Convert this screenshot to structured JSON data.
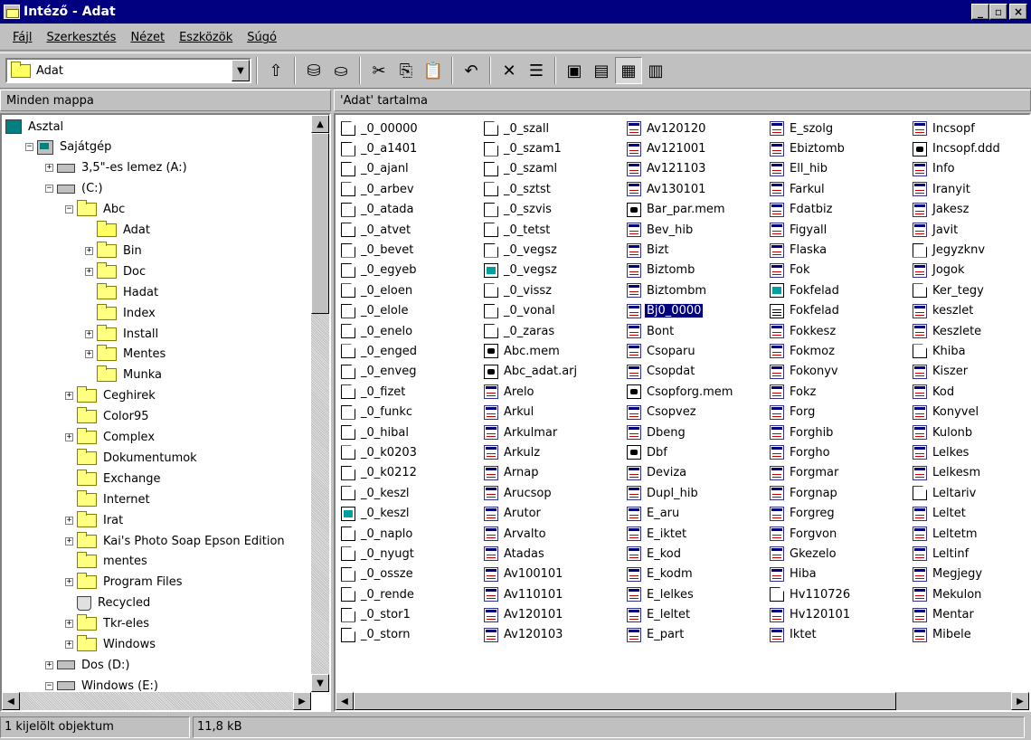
{
  "window": {
    "title": "Intéző - Adat",
    "min_glyph": "_",
    "max_glyph": "▫",
    "close_glyph": "×"
  },
  "menu": [
    "Fájl",
    "Szerkesztés",
    "Nézet",
    "Eszközök",
    "Súgó"
  ],
  "toolbar": {
    "address_value": "Adat",
    "dropdown_glyph": "▼",
    "buttons": [
      {
        "name": "up-folder-button",
        "glyph": "⇧"
      },
      {
        "name": "map-drive-button",
        "glyph": "⛁"
      },
      {
        "name": "disconnect-drive-button",
        "glyph": "⛀"
      },
      {
        "name": "cut-button",
        "glyph": "✂"
      },
      {
        "name": "copy-button",
        "glyph": "⎘"
      },
      {
        "name": "paste-button",
        "glyph": "📋"
      },
      {
        "name": "undo-button",
        "glyph": "↶"
      },
      {
        "name": "delete-button",
        "glyph": "✕"
      },
      {
        "name": "properties-button",
        "glyph": "☰"
      },
      {
        "name": "large-icons-button",
        "glyph": "▣"
      },
      {
        "name": "small-icons-button",
        "glyph": "▤"
      },
      {
        "name": "list-view-button",
        "glyph": "▦"
      },
      {
        "name": "details-view-button",
        "glyph": "▥"
      }
    ]
  },
  "left_pane": {
    "header": "Minden mappa",
    "tree": [
      {
        "label": "Asztal",
        "icon": "desktop-icon",
        "indent": 0,
        "pm": ""
      },
      {
        "label": "Sajátgép",
        "icon": "computer-icon",
        "indent": 1,
        "pm": "−"
      },
      {
        "label": "3,5\"-es lemez (A:)",
        "icon": "floppy-drive-icon",
        "indent": 2,
        "pm": "+"
      },
      {
        "label": "(C:)",
        "icon": "hard-drive-icon",
        "indent": 2,
        "pm": "−"
      },
      {
        "label": "Abc",
        "icon": "folder-icon",
        "indent": 3,
        "pm": "−"
      },
      {
        "label": "Adat",
        "icon": "open-folder-icon",
        "indent": 4,
        "pm": ""
      },
      {
        "label": "Bin",
        "icon": "folder-icon",
        "indent": 4,
        "pm": "+"
      },
      {
        "label": "Doc",
        "icon": "folder-icon",
        "indent": 4,
        "pm": "+"
      },
      {
        "label": "Hadat",
        "icon": "folder-icon",
        "indent": 4,
        "pm": ""
      },
      {
        "label": "Index",
        "icon": "folder-icon",
        "indent": 4,
        "pm": ""
      },
      {
        "label": "Install",
        "icon": "folder-icon",
        "indent": 4,
        "pm": "+"
      },
      {
        "label": "Mentes",
        "icon": "folder-icon",
        "indent": 4,
        "pm": "+"
      },
      {
        "label": "Munka",
        "icon": "folder-icon",
        "indent": 4,
        "pm": ""
      },
      {
        "label": "Ceghirek",
        "icon": "folder-icon",
        "indent": 3,
        "pm": "+"
      },
      {
        "label": "Color95",
        "icon": "folder-icon",
        "indent": 3,
        "pm": ""
      },
      {
        "label": "Complex",
        "icon": "folder-icon",
        "indent": 3,
        "pm": "+"
      },
      {
        "label": "Dokumentumok",
        "icon": "folder-icon",
        "indent": 3,
        "pm": ""
      },
      {
        "label": "Exchange",
        "icon": "folder-icon",
        "indent": 3,
        "pm": ""
      },
      {
        "label": "Internet",
        "icon": "folder-icon",
        "indent": 3,
        "pm": ""
      },
      {
        "label": "Irat",
        "icon": "folder-icon",
        "indent": 3,
        "pm": "+"
      },
      {
        "label": "Kai's Photo Soap Epson Edition",
        "icon": "folder-icon",
        "indent": 3,
        "pm": "+"
      },
      {
        "label": "mentes",
        "icon": "folder-icon",
        "indent": 3,
        "pm": ""
      },
      {
        "label": "Program Files",
        "icon": "folder-icon",
        "indent": 3,
        "pm": "+"
      },
      {
        "label": "Recycled",
        "icon": "recycle-bin-icon",
        "indent": 3,
        "pm": ""
      },
      {
        "label": "Tkr-eles",
        "icon": "folder-icon",
        "indent": 3,
        "pm": "+"
      },
      {
        "label": "Windows",
        "icon": "folder-icon",
        "indent": 3,
        "pm": "+"
      },
      {
        "label": "Dos (D:)",
        "icon": "hard-drive-icon",
        "indent": 2,
        "pm": "+"
      },
      {
        "label": "Windows (E:)",
        "icon": "hard-drive-icon",
        "indent": 2,
        "pm": "−"
      }
    ]
  },
  "right_pane": {
    "header": "'Adat' tartalma",
    "columns": [
      [
        {
          "n": "_0_00000",
          "t": "doc"
        },
        {
          "n": "_0_a1401",
          "t": "doc"
        },
        {
          "n": "_0_ajanl",
          "t": "doc"
        },
        {
          "n": "_0_arbev",
          "t": "doc"
        },
        {
          "n": "_0_atada",
          "t": "doc"
        },
        {
          "n": "_0_atvet",
          "t": "doc"
        },
        {
          "n": "_0_bevet",
          "t": "doc"
        },
        {
          "n": "_0_egyeb",
          "t": "doc"
        },
        {
          "n": "_0_eloen",
          "t": "doc"
        },
        {
          "n": "_0_elole",
          "t": "doc"
        },
        {
          "n": "_0_enelo",
          "t": "doc"
        },
        {
          "n": "_0_enged",
          "t": "doc"
        },
        {
          "n": "_0_enveg",
          "t": "doc"
        },
        {
          "n": "_0_fizet",
          "t": "doc"
        },
        {
          "n": "_0_funkc",
          "t": "doc"
        },
        {
          "n": "_0_hibal",
          "t": "doc"
        },
        {
          "n": "_0_k0203",
          "t": "doc"
        },
        {
          "n": "_0_k0212",
          "t": "doc"
        },
        {
          "n": "_0_keszl",
          "t": "doc"
        },
        {
          "n": "_0_keszl",
          "t": "wiz"
        },
        {
          "n": "_0_naplo",
          "t": "doc"
        },
        {
          "n": "_0_nyugt",
          "t": "doc"
        },
        {
          "n": "_0_osszе",
          "t": "doc"
        },
        {
          "n": "_0_rende",
          "t": "doc"
        },
        {
          "n": "_0_stor1",
          "t": "doc"
        },
        {
          "n": "_0_storn",
          "t": "doc"
        }
      ],
      [
        {
          "n": "_0_szall",
          "t": "doc"
        },
        {
          "n": "_0_szam1",
          "t": "doc"
        },
        {
          "n": "_0_szaml",
          "t": "doc"
        },
        {
          "n": "_0_sztst",
          "t": "doc"
        },
        {
          "n": "_0_szvis",
          "t": "doc"
        },
        {
          "n": "_0_tetst",
          "t": "doc"
        },
        {
          "n": "_0_vegsz",
          "t": "doc"
        },
        {
          "n": "_0_vegsz",
          "t": "wiz"
        },
        {
          "n": "_0_vissz",
          "t": "doc"
        },
        {
          "n": "_0_vonal",
          "t": "doc"
        },
        {
          "n": "_0_zaras",
          "t": "doc"
        },
        {
          "n": "Abc.mem",
          "t": "mem"
        },
        {
          "n": "Abc_adat.arj",
          "t": "mem"
        },
        {
          "n": "Arelo",
          "t": "form"
        },
        {
          "n": "Arkul",
          "t": "form"
        },
        {
          "n": "Arkulmar",
          "t": "form"
        },
        {
          "n": "Arkulz",
          "t": "form"
        },
        {
          "n": "Arnap",
          "t": "form"
        },
        {
          "n": "Arucsop",
          "t": "form"
        },
        {
          "n": "Arutor",
          "t": "form"
        },
        {
          "n": "Arvalto",
          "t": "form"
        },
        {
          "n": "Atadas",
          "t": "form"
        },
        {
          "n": "Av100101",
          "t": "form"
        },
        {
          "n": "Av110101",
          "t": "form"
        },
        {
          "n": "Av120101",
          "t": "form"
        },
        {
          "n": "Av120103",
          "t": "form"
        }
      ],
      [
        {
          "n": "Av120120",
          "t": "form"
        },
        {
          "n": "Av121001",
          "t": "form"
        },
        {
          "n": "Av121103",
          "t": "form"
        },
        {
          "n": "Av130101",
          "t": "form"
        },
        {
          "n": "Bar_par.mem",
          "t": "mem"
        },
        {
          "n": "Bev_hib",
          "t": "form"
        },
        {
          "n": "Bizt",
          "t": "form"
        },
        {
          "n": "Biztomb",
          "t": "form"
        },
        {
          "n": "Biztombm",
          "t": "form"
        },
        {
          "n": "Bj0_0000",
          "t": "form",
          "sel": true
        },
        {
          "n": "Bont",
          "t": "form"
        },
        {
          "n": "Csoparu",
          "t": "form"
        },
        {
          "n": "Csopdat",
          "t": "form"
        },
        {
          "n": "Csopforg.mem",
          "t": "mem"
        },
        {
          "n": "Csopvez",
          "t": "form"
        },
        {
          "n": "Dbeng",
          "t": "form"
        },
        {
          "n": "Dbf",
          "t": "mem"
        },
        {
          "n": "Deviza",
          "t": "form"
        },
        {
          "n": "Dupl_hib",
          "t": "form"
        },
        {
          "n": "E_aru",
          "t": "form"
        },
        {
          "n": "E_iktet",
          "t": "form"
        },
        {
          "n": "E_kod",
          "t": "form"
        },
        {
          "n": "E_kodm",
          "t": "form"
        },
        {
          "n": "E_lelkes",
          "t": "form"
        },
        {
          "n": "E_leltet",
          "t": "form"
        },
        {
          "n": "E_part",
          "t": "form"
        }
      ],
      [
        {
          "n": "E_szolg",
          "t": "form"
        },
        {
          "n": "Ebiztomb",
          "t": "form"
        },
        {
          "n": "Ell_hib",
          "t": "form"
        },
        {
          "n": "Farkul",
          "t": "form"
        },
        {
          "n": "Fdatbiz",
          "t": "form"
        },
        {
          "n": "Figyall",
          "t": "form"
        },
        {
          "n": "Flaska",
          "t": "form"
        },
        {
          "n": "Fok",
          "t": "form"
        },
        {
          "n": "Fokfelad",
          "t": "wiz"
        },
        {
          "n": "Fokfelad",
          "t": "txt"
        },
        {
          "n": "Fokkesz",
          "t": "form"
        },
        {
          "n": "Fokmoz",
          "t": "form"
        },
        {
          "n": "Fokonyv",
          "t": "form"
        },
        {
          "n": "Fokz",
          "t": "form"
        },
        {
          "n": "Forg",
          "t": "form"
        },
        {
          "n": "Forghib",
          "t": "form"
        },
        {
          "n": "Forgho",
          "t": "form"
        },
        {
          "n": "Forgmar",
          "t": "form"
        },
        {
          "n": "Forgnap",
          "t": "form"
        },
        {
          "n": "Forgreg",
          "t": "form"
        },
        {
          "n": "Forgvon",
          "t": "form"
        },
        {
          "n": "Gkezelo",
          "t": "form"
        },
        {
          "n": "Hiba",
          "t": "form"
        },
        {
          "n": "Hv110726",
          "t": "doc"
        },
        {
          "n": "Hv120101",
          "t": "form"
        },
        {
          "n": "Iktet",
          "t": "form"
        }
      ],
      [
        {
          "n": "Incsopf",
          "t": "form"
        },
        {
          "n": "Incsopf.ddd",
          "t": "mem"
        },
        {
          "n": "Info",
          "t": "form"
        },
        {
          "n": "Iranyit",
          "t": "form"
        },
        {
          "n": "Jakesz",
          "t": "form"
        },
        {
          "n": "Javit",
          "t": "form"
        },
        {
          "n": "Jegyzknv",
          "t": "doc"
        },
        {
          "n": "Jogok",
          "t": "form"
        },
        {
          "n": "Ker_tegy",
          "t": "doc"
        },
        {
          "n": "keszlet",
          "t": "form"
        },
        {
          "n": "Keszlete",
          "t": "form"
        },
        {
          "n": "Khiba",
          "t": "doc"
        },
        {
          "n": "Kiszer",
          "t": "form"
        },
        {
          "n": "Kod",
          "t": "form"
        },
        {
          "n": "Konyvel",
          "t": "form"
        },
        {
          "n": "Kulonb",
          "t": "form"
        },
        {
          "n": "Lelkes",
          "t": "form"
        },
        {
          "n": "Lelkesm",
          "t": "form"
        },
        {
          "n": "Leltariv",
          "t": "doc"
        },
        {
          "n": "Leltet",
          "t": "form"
        },
        {
          "n": "Leltetm",
          "t": "form"
        },
        {
          "n": "Leltinf",
          "t": "form"
        },
        {
          "n": "Megjegy",
          "t": "form"
        },
        {
          "n": "Mekulon",
          "t": "form"
        },
        {
          "n": "Mentar",
          "t": "form"
        },
        {
          "n": "Mibele",
          "t": "form"
        }
      ]
    ]
  },
  "status": {
    "selection": "1 kijelölt objektum",
    "size": "11,8 kB"
  }
}
